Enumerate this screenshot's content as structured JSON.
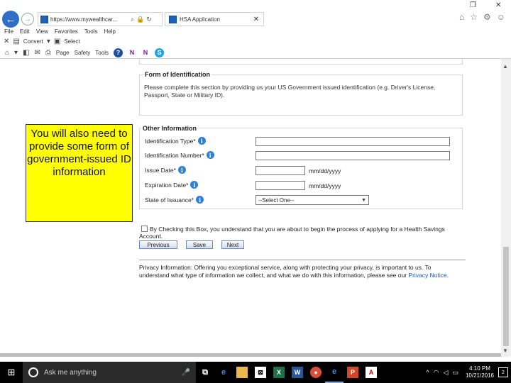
{
  "browser": {
    "address_text": "https://www.mywealthcar...",
    "tab_title": "HSA Application",
    "menu": [
      "File",
      "Edit",
      "View",
      "Favorites",
      "Tools",
      "Help"
    ],
    "fav_convert": "Convert",
    "fav_select": "Select",
    "cmd_page": "Page",
    "cmd_safety": "Safety",
    "cmd_tools": "Tools"
  },
  "form": {
    "identification_legend": "Form of Identification",
    "identification_text": "Please complete this section by providing us your US Government issued identification (e.g. Driver's License, Passport, State or Military ID).",
    "other_legend": "Other Information",
    "fields": {
      "id_type": "Identification Type*",
      "id_number": "Identification Number*",
      "issue_date": "Issue Date*",
      "expiration_date": "Expiration Date*",
      "state": "State of Issuance*"
    },
    "date_format": "mm/dd/yyyy",
    "state_select": "--Select One--",
    "consent_text": "By Checking this Box, you understand that you are about to begin the process of applying for a Health Savings Account.",
    "buttons": {
      "previous": "Previous",
      "save": "Save",
      "next": "Next"
    },
    "privacy_text": "Privacy Information: Offering you exceptional service, along with protecting your privacy, is important to us. To understand what type of information we collect, and what we do with this information, please see our",
    "privacy_link": "Privacy Notice",
    "privacy_end": "."
  },
  "callout": "You will also need to provide some form of government-issued ID information",
  "taskbar": {
    "search_placeholder": "Ask me anything",
    "time": "4:10 PM",
    "date": "10/21/2016",
    "notifications": "2"
  }
}
